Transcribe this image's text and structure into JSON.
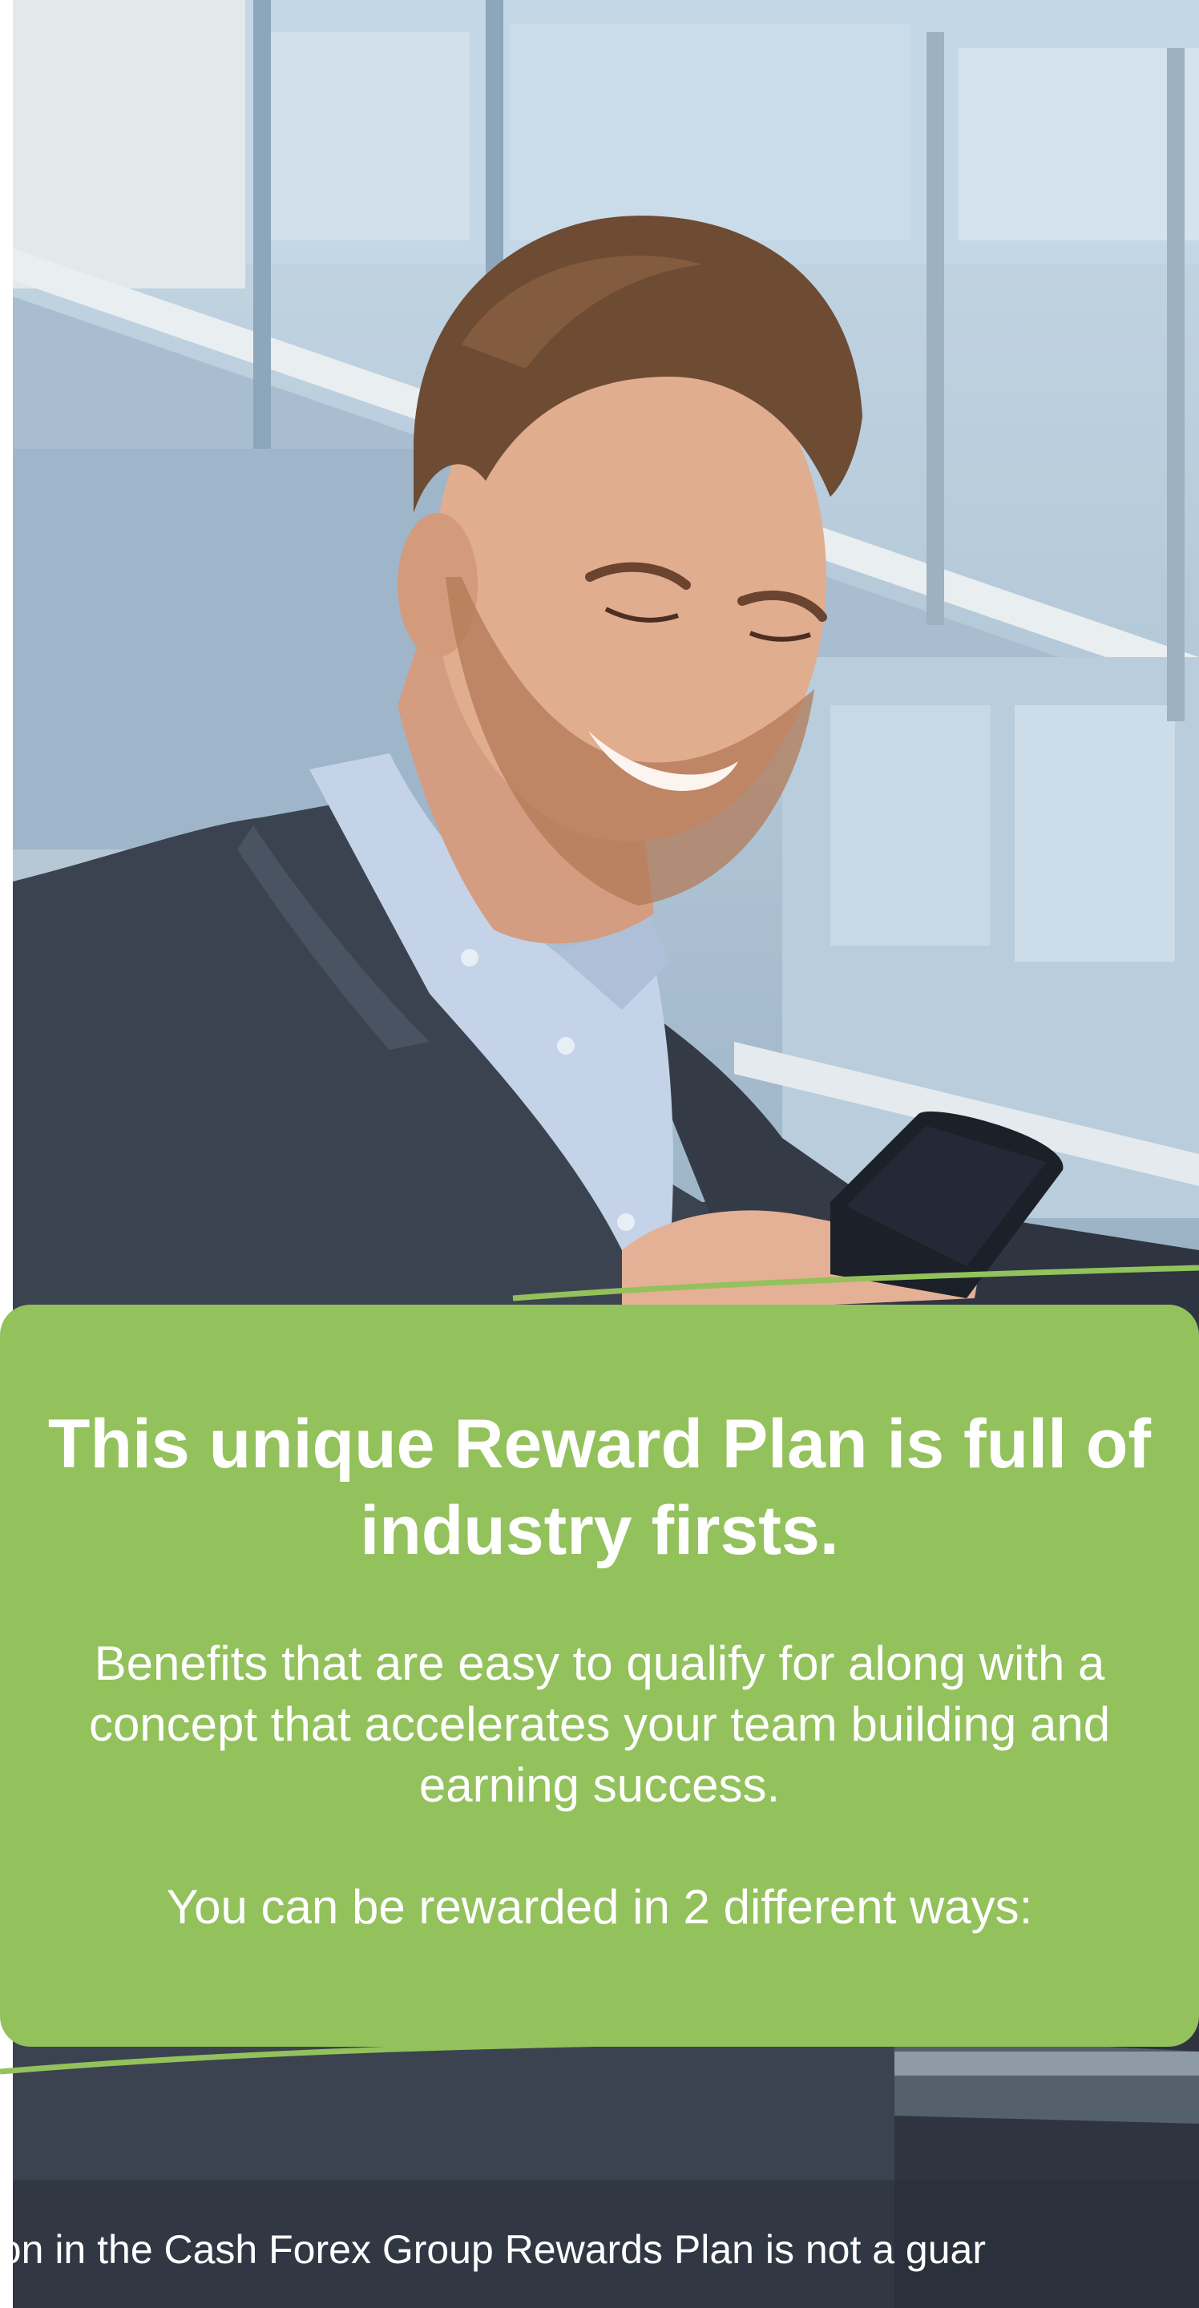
{
  "hero": {
    "headline": "This unique Reward Plan is full of industry firsts.",
    "benefits": "Benefits that are easy to qualify for along with a concept that accelerates your team building  and earning success.",
    "ways": "You can be rewarded in 2 different ways:"
  },
  "footer": {
    "disclaimer": "ation in the Cash Forex Group Rewards Plan is not a guar"
  },
  "colors": {
    "card_green": "#93c15c",
    "text": "#ffffff",
    "suit": "#3b4350",
    "shirt": "#c4d3e8"
  }
}
